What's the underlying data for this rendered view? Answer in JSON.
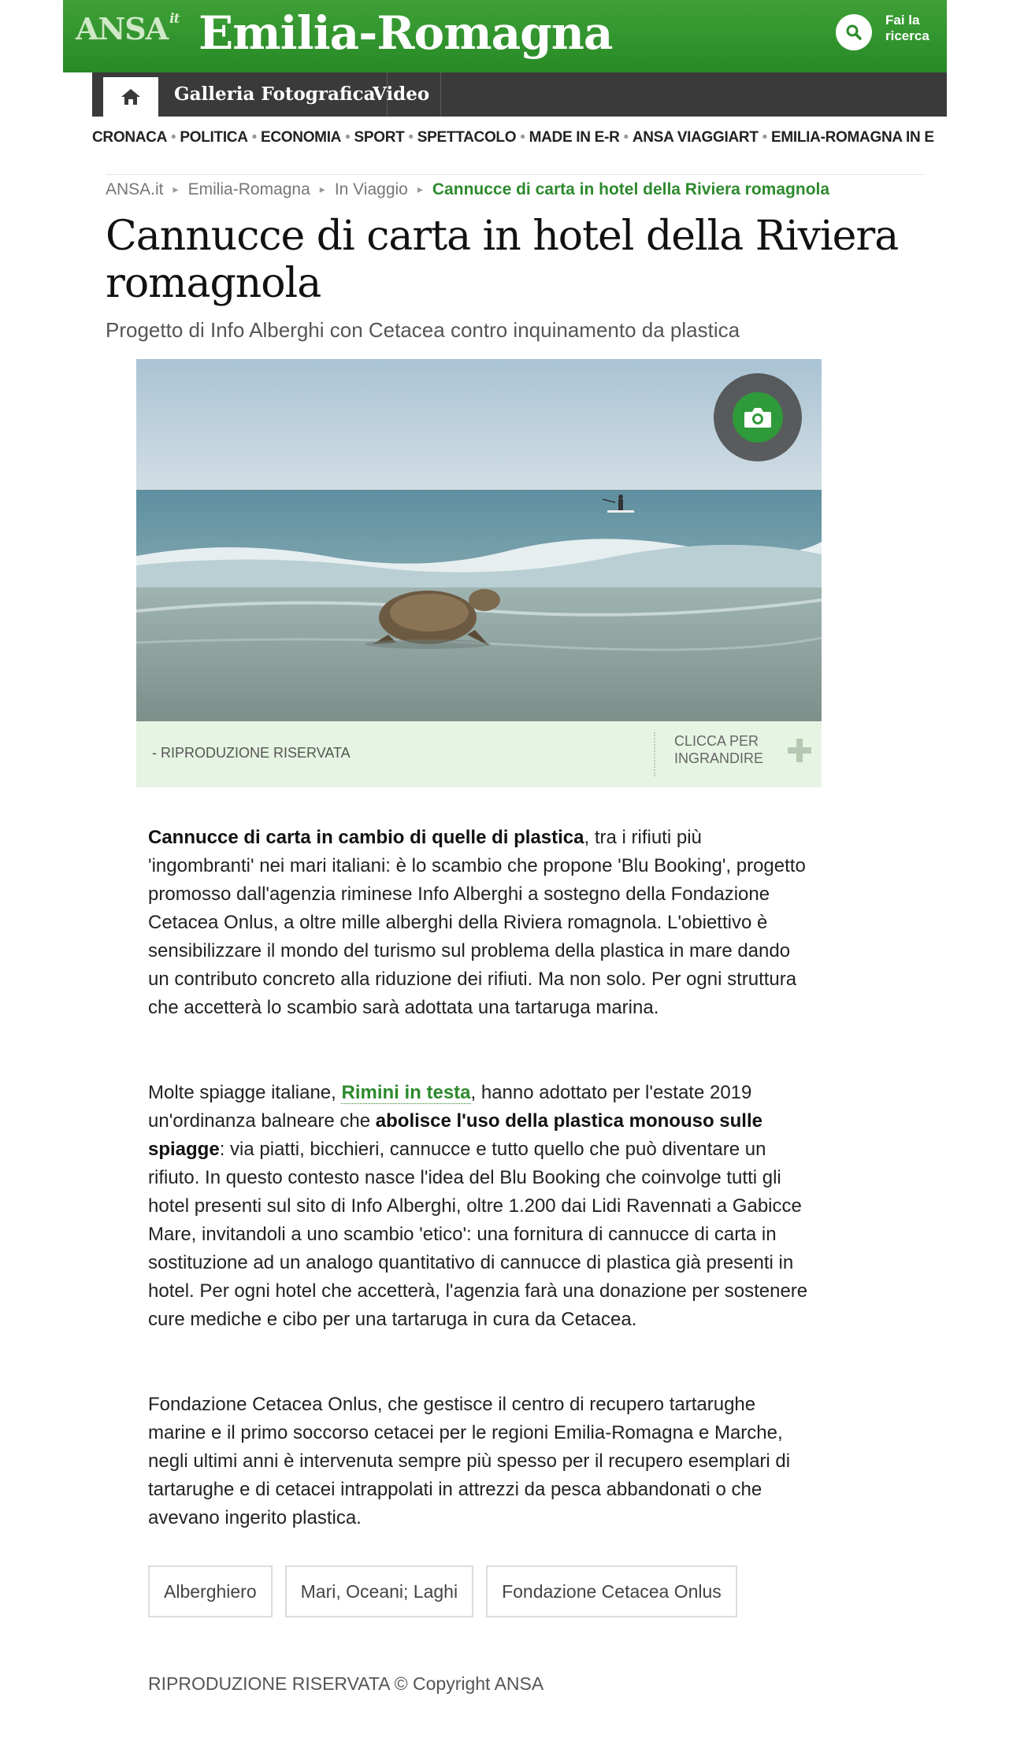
{
  "header": {
    "brand": "ANSA",
    "brand_suffix": "it",
    "region": "Emilia-Romagna",
    "search_label": "Fai la ricerca"
  },
  "nav": {
    "home_icon": "home-icon",
    "items": [
      "Galleria Fotografica",
      "Video"
    ]
  },
  "sections": [
    "CRONACA",
    "POLITICA",
    "ECONOMIA",
    "SPORT",
    "SPETTACOLO",
    "MADE IN E-R",
    "ANSA VIAGGIART",
    "EMILIA-ROMAGNA IN E"
  ],
  "breadcrumb": [
    "ANSA.it",
    "Emilia-Romagna",
    "In Viaggio",
    "Cannucce di carta in hotel della Riviera romagnola"
  ],
  "article": {
    "title": "Cannucce di carta in hotel della Riviera romagnola",
    "subtitle": "Progetto di Info Alberghi con Cetacea contro inquinamento da plastica",
    "photo_caption": "- RIPRODUZIONE RISERVATA",
    "enlarge_label_1": "CLICCA PER",
    "enlarge_label_2": "INGRANDIRE",
    "p1_bold": "Cannucce di carta in cambio di quelle di plastica",
    "p1_rest": ", tra i rifiuti più 'ingombranti' nei mari italiani: è lo scambio che propone 'Blu Booking', progetto promosso dall'agenzia riminese Info Alberghi a sostegno della Fondazione Cetacea Onlus, a oltre mille alberghi della Riviera romagnola. L'obiettivo è sensibilizzare il mondo del turismo sul problema della plastica in mare dando un contributo concreto alla riduzione dei rifiuti. Ma non solo. Per ogni struttura che accetterà lo scambio sarà adottata una tartaruga marina.",
    "p2_a": "Molte spiagge italiane, ",
    "p2_link": "Rimini in testa",
    "p2_b": ", hanno adottato per l'estate 2019 un'ordinanza balneare che ",
    "p2_bold": "abolisce l'uso della plastica monouso sulle spiagge",
    "p2_c": ": via piatti, bicchieri, cannucce e tutto quello che può diventare un rifiuto. In questo contesto nasce l'idea del Blu Booking che coinvolge tutti gli hotel presenti sul sito di Info Alberghi, oltre 1.200 dai Lidi Ravennati a Gabicce Mare, invitandoli a uno scambio 'etico': una fornitura di cannucce di carta in sostituzione ad un analogo quantitativo di cannucce di plastica già presenti in hotel. Per ogni hotel che accetterà, l'agenzia farà una donazione per sostenere cure mediche e cibo per una tartaruga in cura da Cetacea.",
    "p3": "Fondazione Cetacea Onlus, che gestisce il centro di recupero tartarughe marine e il primo soccorso cetacei per le regioni Emilia-Romagna e Marche, negli ultimi anni è intervenuta sempre più spesso per il recupero esemplari di tartarughe e di cetacei intrappolati in attrezzi da pesca abbandonati o che avevano ingerito plastica.",
    "tags": [
      "Alberghiero",
      "Mari, Oceani; Laghi",
      "Fondazione Cetacea Onlus"
    ],
    "copyright": "RIPRODUZIONE RISERVATA © Copyright ANSA"
  },
  "colors": {
    "brand_green": "#2d8a2d",
    "nav_dark": "#3a3a3a",
    "caption_bg": "#e6f4e3"
  }
}
